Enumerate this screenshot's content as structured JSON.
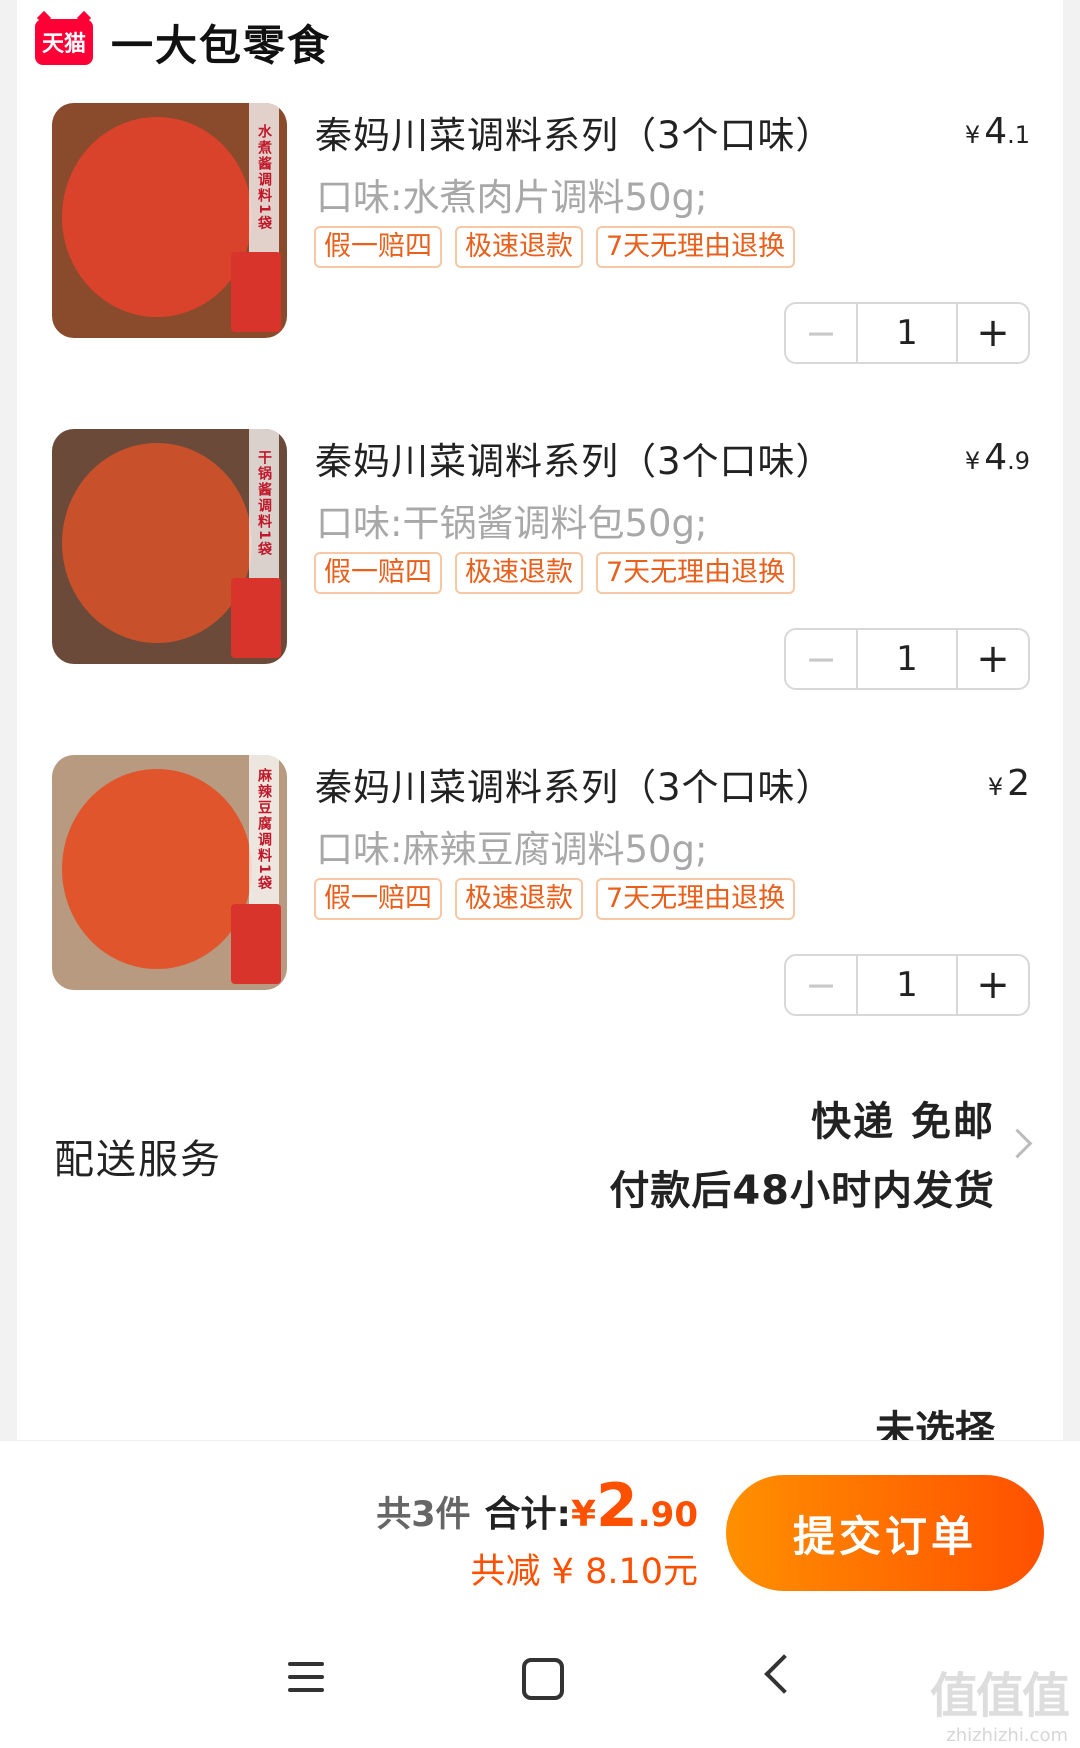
{
  "shop": {
    "logo_text": "天猫",
    "name": "一大包零食"
  },
  "items": [
    {
      "title": "秦妈川菜调料系列（3个口味）",
      "price_symbol": "¥",
      "price_int": "4",
      "price_dec": ".1",
      "spec": "口味:水煮肉片调料50g;",
      "image_label": "水煮酱调料1袋",
      "tags": [
        "假一赔四",
        "极速退款",
        "7天无理由退换"
      ],
      "quantity": "1",
      "bowl_color": "#d9432b"
    },
    {
      "title": "秦妈川菜调料系列（3个口味）",
      "price_symbol": "¥",
      "price_int": "4",
      "price_dec": ".9",
      "spec": "口味:干锅酱调料包50g;",
      "image_label": "干锅酱调料1袋",
      "tags": [
        "假一赔四",
        "极速退款",
        "7天无理由退换"
      ],
      "quantity": "1",
      "bowl_color": "#c8502a"
    },
    {
      "title": "秦妈川菜调料系列（3个口味）",
      "price_symbol": "¥",
      "price_int": "2",
      "price_dec": "",
      "spec": "口味:麻辣豆腐调料50g;",
      "image_label": "麻辣豆腐调料1袋",
      "tags": [
        "假一赔四",
        "极速退款",
        "7天无理由退换"
      ],
      "quantity": "1",
      "bowl_color": "#e0552c"
    }
  ],
  "stepper": {
    "minus": "−",
    "plus": "+"
  },
  "delivery": {
    "label": "配送服务",
    "line1": "快递 免邮",
    "line2": "付款后48小时内发货"
  },
  "next_row_value": "未选择",
  "summary": {
    "count": "共3件",
    "total_label": "合计:",
    "total_symbol": "¥",
    "total_int": "2",
    "total_dec": ".90",
    "discount": "共减 ¥ 8.10元",
    "submit": "提交订单"
  },
  "watermark": {
    "text": "值值值",
    "url": "zhizhizhi.com"
  },
  "colors": {
    "accent": "#ff5000",
    "tag_text": "#e8601c",
    "tmall_red": "#ff0036"
  }
}
